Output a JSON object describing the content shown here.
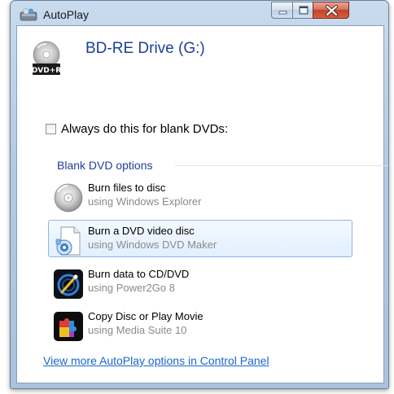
{
  "window": {
    "title": "AutoPlay"
  },
  "titlebar": {
    "buttons": [
      {
        "name": "minimize",
        "icon": "minimize-icon"
      },
      {
        "name": "maximize",
        "icon": "maximize-icon"
      },
      {
        "name": "close",
        "icon": "close-icon"
      }
    ]
  },
  "drive": {
    "title": "BD-RE Drive (G:)",
    "icon": "dvd-r-disc-icon",
    "icon_label": "DVD+R"
  },
  "checkbox": {
    "label": "Always do this for blank DVDs:",
    "checked": false
  },
  "group": {
    "header": "Blank DVD options"
  },
  "options": [
    {
      "title": "Burn files to disc",
      "subtitle": "using Windows Explorer",
      "icon": "disc-icon",
      "selected": false
    },
    {
      "title": "Burn a DVD video disc",
      "subtitle": "using Windows DVD Maker",
      "icon": "dvd-maker-icon",
      "selected": true
    },
    {
      "title": "Burn data to CD/DVD",
      "subtitle": "using Power2Go 8",
      "icon": "power2go-icon",
      "selected": false
    },
    {
      "title": "Copy Disc or Play Movie",
      "subtitle": "using Media Suite 10",
      "icon": "media-suite-icon",
      "selected": false
    }
  ],
  "footer": {
    "link": "View more AutoPlay options in Control Panel"
  },
  "colors": {
    "accent_text": "#1e3f9a",
    "link": "#1a66cc",
    "selected_bg": "#e1efff",
    "selected_border": "#8fb6e3",
    "close_button": "#c2412a"
  }
}
